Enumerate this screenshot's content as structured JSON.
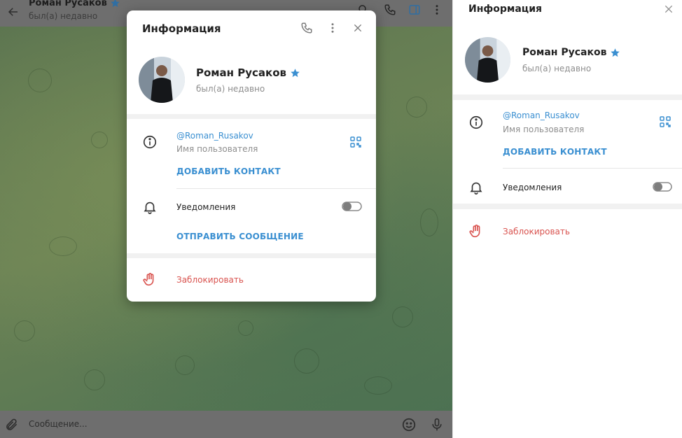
{
  "chat": {
    "contact_name": "Роман Русаков",
    "contact_status": "был(а) недавно",
    "composer_placeholder": "Сообщение..."
  },
  "modal": {
    "title": "Информация",
    "name": "Роман Русаков",
    "status": "был(а) недавно",
    "username": "@Roman_Rusakov",
    "username_label": "Имя пользователя",
    "add_contact": "ДОБАВИТЬ КОНТАКТ",
    "notifications_label": "Уведомления",
    "notifications_on": false,
    "send_message": "ОТПРАВИТЬ СООБЩЕНИЕ",
    "block": "Заблокировать"
  },
  "right_panel": {
    "title": "Информация",
    "name": "Роман Русаков",
    "status": "был(а) недавно",
    "username": "@Roman_Rusakov",
    "username_label": "Имя пользователя",
    "add_contact": "ДОБАВИТЬ КОНТАКТ",
    "notifications_label": "Уведомления",
    "notifications_on": false,
    "block": "Заблокировать"
  },
  "colors": {
    "accent": "#3a8fd1",
    "danger": "#d9534f",
    "premium_star": "#3a8fd1"
  }
}
